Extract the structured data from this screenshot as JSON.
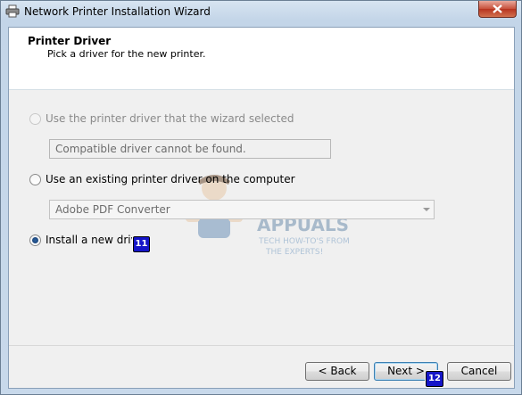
{
  "window": {
    "title": "Network Printer Installation Wizard"
  },
  "header": {
    "title": "Printer Driver",
    "subtitle": "Pick a driver for the new printer."
  },
  "options": [
    {
      "label": "Use the printer driver that the wizard selected",
      "selected": false,
      "enabled": false
    },
    {
      "label": "Use an existing printer driver on the computer",
      "selected": false,
      "enabled": true
    },
    {
      "label": "Install a new driver",
      "selected": true,
      "enabled": true
    }
  ],
  "wizard_driver_field": {
    "value": "Compatible driver cannot be found."
  },
  "existing_driver_select": {
    "value": "Adobe PDF Converter"
  },
  "watermark": {
    "brand": "APPUALS",
    "tagline_1": "TECH HOW-TO'S FROM",
    "tagline_2": "THE EXPERTS!"
  },
  "annotations": {
    "badge_install": "11",
    "badge_next": "12"
  },
  "buttons": {
    "back": "< Back",
    "next": "Next >",
    "cancel": "Cancel"
  },
  "colors": {
    "badge": "#1515c8",
    "titlebar_close": "#c7503b",
    "watermark": "#7a9fc4"
  }
}
